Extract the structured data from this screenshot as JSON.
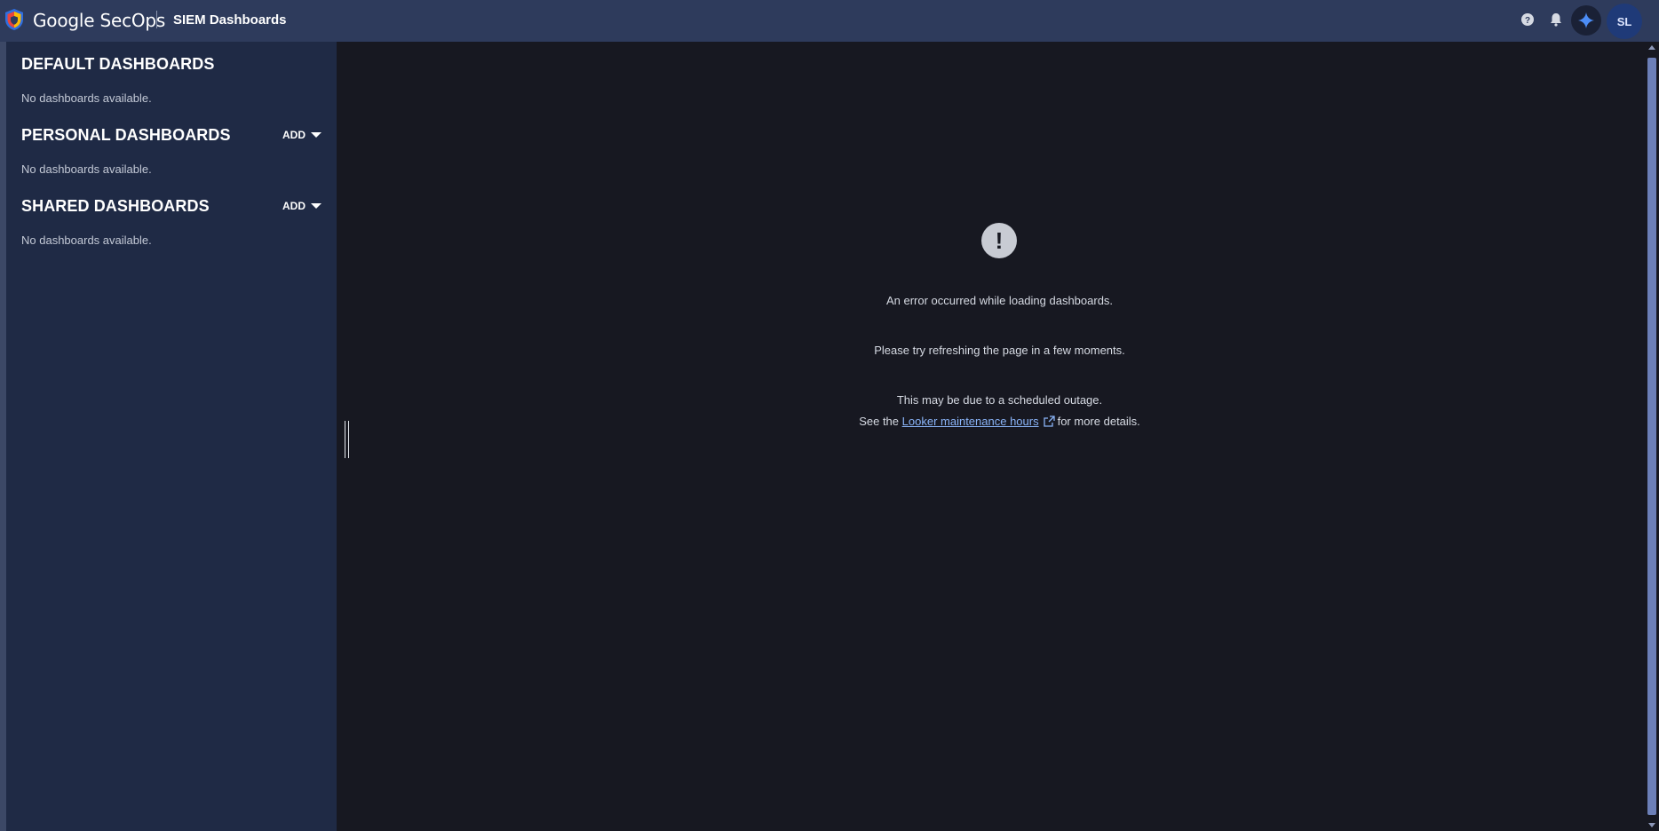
{
  "header": {
    "brand": "Google SecOps",
    "app_title": "SIEM Dashboards",
    "avatar_initials": "SL",
    "icons": [
      "shield-logo-icon",
      "help-icon",
      "bell-icon",
      "sparkle-icon"
    ]
  },
  "sidebar": {
    "sections": [
      {
        "title": "DEFAULT DASHBOARDS",
        "empty_text": "No dashboards available."
      },
      {
        "title": "PERSONAL DASHBOARDS",
        "add_label": "ADD",
        "empty_text": "No dashboards available."
      },
      {
        "title": "SHARED DASHBOARDS",
        "add_label": "ADD",
        "empty_text": "No dashboards available."
      }
    ]
  },
  "main": {
    "error_line": "An error occurred while loading dashboards.",
    "refresh_line": "Please try refreshing the page in a few moments.",
    "outage_line": "This may be due to a scheduled outage.",
    "see_prefix": "See the",
    "link_text": "Looker maintenance hours",
    "see_suffix": "for more details.",
    "error_icon": "exclamation-icon"
  },
  "colors": {
    "topbar": "#2e3b5c",
    "sidebar": "#1f2a45",
    "main_bg": "#171821",
    "link": "#8ab4f8",
    "scroll_thumb": "#6c7fb8"
  }
}
